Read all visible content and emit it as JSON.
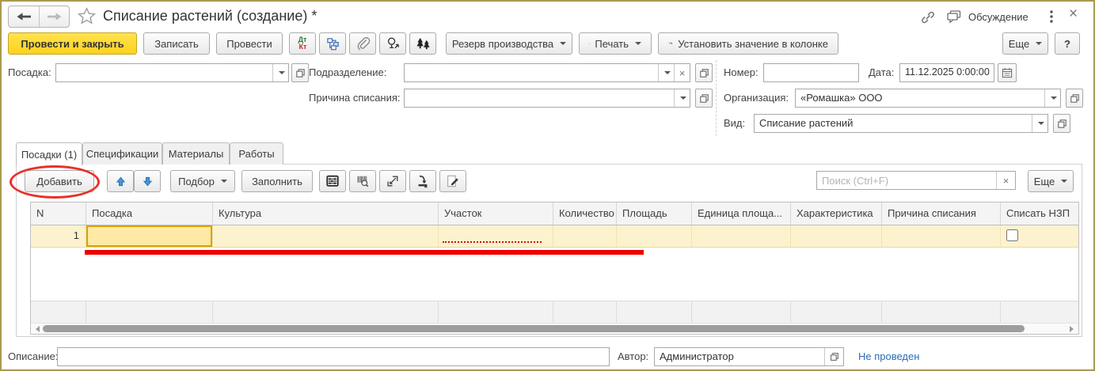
{
  "window": {
    "title": "Списание растений (создание) *",
    "discussion_label": "Обсуждение"
  },
  "toolbar": {
    "post_close": "Провести и закрыть",
    "save": "Записать",
    "post": "Провести",
    "dtkt_top": "Дт",
    "dtkt_bottom": "Кт",
    "reserve": "Резерв производства",
    "print": "Печать",
    "set_column": "Установить значение в колонке",
    "more": "Еще",
    "help": "?"
  },
  "form": {
    "planting_label": "Посадка:",
    "planting_value": "",
    "department_label": "Подразделение:",
    "department_value": "",
    "reason_label": "Причина списания:",
    "reason_value": "",
    "number_label": "Номер:",
    "number_value": "",
    "date_label": "Дата:",
    "date_value": "11.12.2025  0:00:00",
    "org_label": "Организация:",
    "org_value": "«Ромашка» ООО",
    "kind_label": "Вид:",
    "kind_value": "Списание растений"
  },
  "tabs": [
    {
      "label": "Посадки (1)",
      "active": true
    },
    {
      "label": "Спецификации",
      "active": false
    },
    {
      "label": "Материалы",
      "active": false
    },
    {
      "label": "Работы",
      "active": false
    }
  ],
  "table_toolbar": {
    "add": "Добавить",
    "pick": "Подбор",
    "fill": "Заполнить",
    "search_placeholder": "Поиск (Ctrl+F)",
    "more": "Еще"
  },
  "table": {
    "columns": [
      "N",
      "Посадка",
      "Культура",
      "Участок",
      "Количество",
      "Площадь",
      "Единица площа...",
      "Характеристика",
      "Причина списания",
      "Списать НЗП"
    ],
    "rows": [
      {
        "n": "1",
        "writeoff_nzp_checked": false
      }
    ]
  },
  "footer": {
    "description_label": "Описание:",
    "description_value": "",
    "author_label": "Автор:",
    "author_value": "Администратор",
    "status": "Не проведен"
  },
  "colors": {
    "window_border": "#a89b4f",
    "primary_button": "#ffd11d",
    "row_highlight": "#fcf2cd",
    "selected_cell_border": "#d8a200",
    "annotation_red": "#e8312a",
    "status_link_blue": "#2b6cb8"
  }
}
